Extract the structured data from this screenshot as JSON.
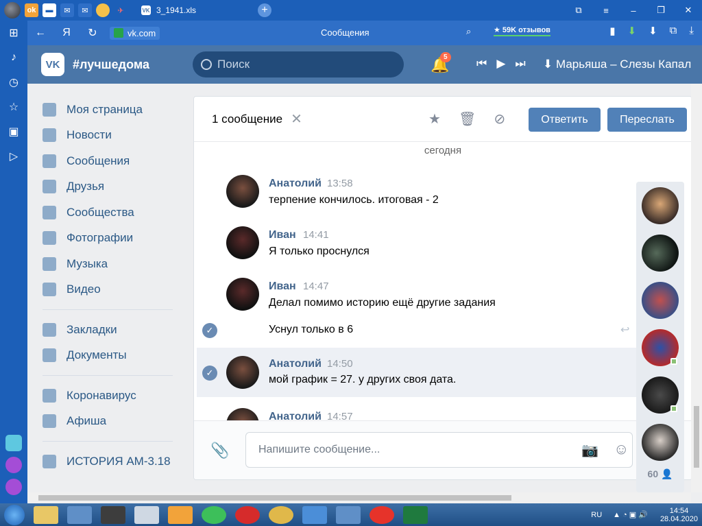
{
  "browser": {
    "tab_title": "3_1941.xls",
    "address": "vk.com",
    "page_title": "Сообщения",
    "reviews": "★ 59K отзывов",
    "nav_back": "←",
    "nav_yandex": "Я",
    "nav_refresh": "↻"
  },
  "vk": {
    "logo": "VK",
    "hashtag": "#лучшедома",
    "search_placeholder": "Поиск",
    "notifications_count": "5",
    "track": "Марьяша – Слезы Капал"
  },
  "nav": {
    "items": [
      {
        "label": "Моя страница",
        "icon": "home-icon"
      },
      {
        "label": "Новости",
        "icon": "news-icon"
      },
      {
        "label": "Сообщения",
        "icon": "messages-icon"
      },
      {
        "label": "Друзья",
        "icon": "friends-icon"
      },
      {
        "label": "Сообщества",
        "icon": "communities-icon"
      },
      {
        "label": "Фотографии",
        "icon": "camera-icon"
      },
      {
        "label": "Музыка",
        "icon": "music-icon"
      },
      {
        "label": "Видео",
        "icon": "video-icon"
      }
    ],
    "items2": [
      {
        "label": "Закладки",
        "icon": "star-icon"
      },
      {
        "label": "Документы",
        "icon": "document-icon"
      }
    ],
    "items3": [
      {
        "label": "Коронавирус",
        "icon": "virus-icon"
      },
      {
        "label": "Афиша",
        "icon": "afisha-icon"
      }
    ],
    "items4": [
      {
        "label": "ИСТОРИЯ АМ-3.18",
        "icon": "group-icon"
      }
    ]
  },
  "conversation": {
    "selected_count": "1 сообщение",
    "reply_label": "Ответить",
    "forward_label": "Переслать",
    "day_label": "сегодня",
    "messages": [
      {
        "author": "Анатолий",
        "time": "13:58",
        "text": "терпение кончилось. итоговая - 2"
      },
      {
        "author": "Иван",
        "time": "14:41",
        "text": "Я только проснулся"
      },
      {
        "author": "Иван",
        "time": "14:47",
        "text": "Делал помимо историю ещё другие задания"
      },
      {
        "author": "",
        "time": "",
        "text": "Уснул только в 6"
      },
      {
        "author": "Анатолий",
        "time": "14:50",
        "text": "мой график = 27. у других своя дата."
      },
      {
        "author": "Анатолий",
        "time": "14:57",
        "text": ""
      }
    ],
    "composer_placeholder": "Напишите сообщение..."
  },
  "chat_list": {
    "members_count": "60"
  },
  "taskbar": {
    "lang": "RU",
    "time": "14:54",
    "date": "28.04.2020"
  },
  "colors": {
    "vk_blue": "#4a76a8",
    "browser_blue": "#1c5fb8",
    "link": "#2a5885",
    "button": "#5181b8"
  }
}
